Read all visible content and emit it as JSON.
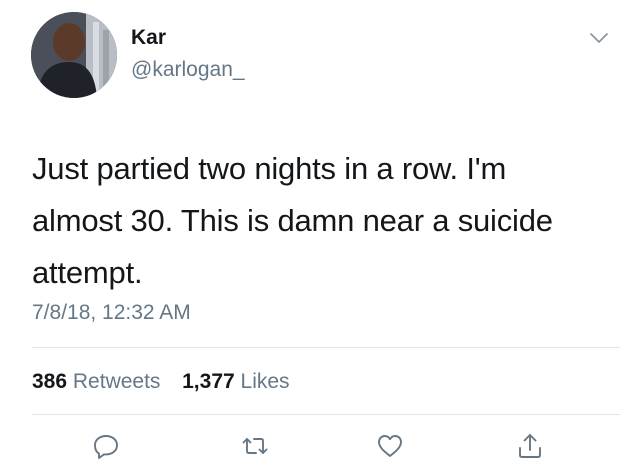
{
  "user": {
    "name": "Kar",
    "handle": "@karlogan_"
  },
  "tweet": {
    "text_lines": [
      "Just partied two nights in a row. I'm",
      "almost 30. This is damn near a suicide",
      "attempt."
    ],
    "timestamp": "7/8/18, 12:32 AM"
  },
  "stats": {
    "retweets_count": "386",
    "retweets_label": "Retweets",
    "likes_count": "1,377",
    "likes_label": "Likes"
  },
  "actions": [
    "reply-icon",
    "retweet-icon",
    "like-icon",
    "share-icon"
  ],
  "colors": {
    "text": "#14171a",
    "secondary": "#657786",
    "divider": "#e1e8ed"
  }
}
